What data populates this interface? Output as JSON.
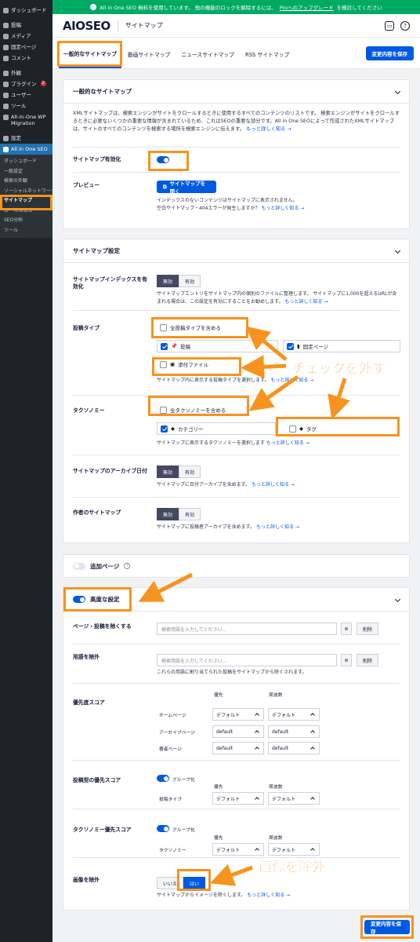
{
  "sidebar": {
    "items": [
      {
        "label": "ダッシュボード"
      },
      {
        "label": "投稿"
      },
      {
        "label": "メディア"
      },
      {
        "label": "固定ページ"
      },
      {
        "label": "コメント"
      },
      {
        "label": "外観"
      },
      {
        "label": "プラグイン",
        "badge": "2"
      },
      {
        "label": "ユーザー"
      },
      {
        "label": "ツール"
      },
      {
        "label": "All-in-One WP Migration"
      },
      {
        "label": "設定"
      },
      {
        "label": "All in One SEO"
      }
    ],
    "submenu": [
      "ダッシュボード",
      "一般設定",
      "検索の外観",
      "ソーシャルネットワーク",
      "サイトマップ",
      "ローカルSEO",
      "SEO分析",
      "ツール"
    ]
  },
  "promo": {
    "text": "All in One SEO 無料を使用しています。 他の機能のロックを解除するには、",
    "link": "Proへのアップグレード",
    "suffix": "を検討してください"
  },
  "header": {
    "logo": "AIOSEO",
    "title": "サイトマップ"
  },
  "tabs": [
    "一般的なサイトマップ",
    "動画サイトマップ",
    "ニュースサイトマップ",
    "RSS サイトマップ"
  ],
  "save_label": "変更内容を保存",
  "general": {
    "title": "一般的なサイトマップ",
    "intro": "XMLサイトマップは、検索エンジンがサイトをクロールするときに使用するすべてのコンテンツのリストです。 検索エンジンがサイトをクロールするときに必要ないくつかの重要な情報が含まれているため、これはSEOの重要な部分です。All in One SEOによって作成されたXMLサイトマップは、サイトのすべてのコンテンツを検索する場所を検索エンジンに伝えます。",
    "learn_more": "もっと詳しく知る →",
    "enable_label": "サイトマップ有効化",
    "preview_label": "プレビュー",
    "open_button": "サイトマップを開く",
    "preview_help1": "インデックスのないコンテンツはサイトマップに表示されません。",
    "preview_help2": "空白サイトマップ・404エラーが発生しますか？"
  },
  "settings": {
    "title": "サイトマップ設定",
    "index_label": "サイトマップインデックスを有効化",
    "off": "無効",
    "on": "有効",
    "index_help": "サイトマップエントリをサイトマップ内の個別のファイルに整理します。 サイトマップに1,000を超えるURLが含まれる場合は、この設定を有効にすることをお勧めします。",
    "post_types_label": "投稿タイプ",
    "all_post_types": "全投稿タイプを含める",
    "post": "投稿",
    "page": "固定ページ",
    "attachment": "添付ファイル",
    "post_types_help": "サイトマップ内に表示する投稿タイプを選択します。",
    "taxonomies_label": "タクソノミー",
    "all_taxonomies": "全タクソノミーを含める",
    "category": "カテゴリー",
    "tag": "タグ",
    "taxonomies_help": "サイトマップに表示するタクソノミーを選択します",
    "archive_label": "サイトマップのアーカイブ日付",
    "archive_help": "サイトマップに日付アーカイブを含めます。",
    "author_label": "作者のサイトマップ",
    "author_help": "サイトマップに投稿者アーカイブを含めます。"
  },
  "additional": {
    "label": "追加ページ"
  },
  "advanced": {
    "label": "高度な設定",
    "exclude_posts_label": "ページ・投稿を除くする",
    "search_placeholder": "検索用語を入力してください...",
    "delete": "削除",
    "exclude_terms_label": "用語を除外",
    "exclude_terms_help": "これらの用語に割り当てられた投稿をサイトマップから除くされます。",
    "priority_label": "優先度スコア",
    "priority_col": "優先",
    "frequency_col": "周波数",
    "rows": [
      {
        "name": "ホームページ",
        "priority": "デフォルト",
        "frequency": "デフォルト"
      },
      {
        "name": "アーカイブページ",
        "priority": "default",
        "frequency": "default"
      },
      {
        "name": "著者ページ",
        "priority": "default",
        "frequency": "default"
      }
    ],
    "post_priority_label": "投稿型の優先スコア",
    "group_label": "グループ化",
    "post_type_row": "投稿タイプ",
    "tax_priority_label": "タクソノミー優先スコア",
    "tax_row": "タクソノミー",
    "default_val": "デフォルト",
    "exclude_images_label": "画像を除外",
    "no": "いいえ",
    "yes": "はい",
    "exclude_images_help": "サイトマップからイメージを除くします。"
  },
  "annotations": {
    "uncheck": "チェックを外す",
    "exclude_images": "画像を除外"
  },
  "colors": {
    "accent": "#005ae0",
    "highlight": "#f7931e",
    "promo": "#00aa63",
    "sidebar": "#1d2327"
  }
}
